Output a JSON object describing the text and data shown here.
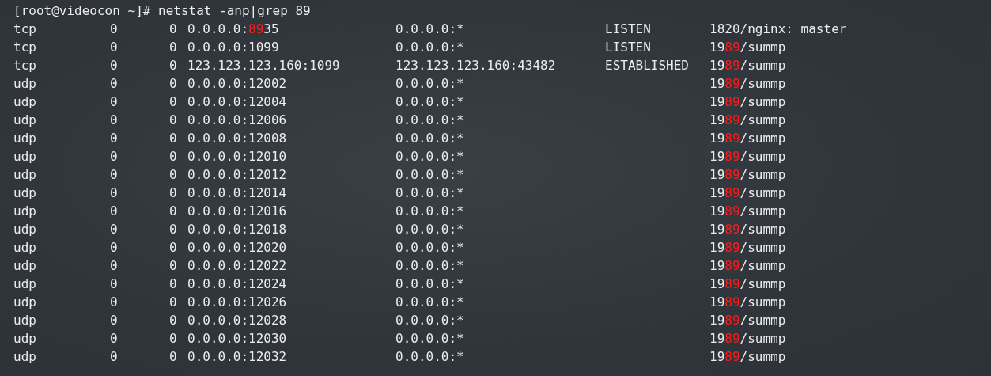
{
  "terminal": {
    "prompt": "[root@videocon ~]# netstat -anp|grep 89",
    "rows": [
      {
        "proto": "tcp",
        "recv_q": "0",
        "send_q": "0",
        "local": [
          {
            "text": "0.0.0.0:",
            "match": false
          },
          {
            "text": "89",
            "match": true
          },
          {
            "text": "35",
            "match": false
          }
        ],
        "foreign": "0.0.0.0:*",
        "state": "LISTEN",
        "program": [
          {
            "text": "1820/nginx: master",
            "match": false
          }
        ]
      },
      {
        "proto": "tcp",
        "recv_q": "0",
        "send_q": "0",
        "local": [
          {
            "text": "0.0.0.0:1099",
            "match": false
          }
        ],
        "foreign": "0.0.0.0:*",
        "state": "LISTEN",
        "program": [
          {
            "text": "19",
            "match": false
          },
          {
            "text": "89",
            "match": true
          },
          {
            "text": "/summp",
            "match": false
          }
        ]
      },
      {
        "proto": "tcp",
        "recv_q": "0",
        "send_q": "0",
        "local": [
          {
            "text": "123.123.123.160:1099",
            "match": false
          }
        ],
        "foreign": "123.123.123.160:43482",
        "state": "ESTABLISHED",
        "program": [
          {
            "text": "19",
            "match": false
          },
          {
            "text": "89",
            "match": true
          },
          {
            "text": "/summp",
            "match": false
          }
        ]
      },
      {
        "proto": "udp",
        "recv_q": "0",
        "send_q": "0",
        "local": [
          {
            "text": "0.0.0.0:12002",
            "match": false
          }
        ],
        "foreign": "0.0.0.0:*",
        "program": [
          {
            "text": "19",
            "match": false
          },
          {
            "text": "89",
            "match": true
          },
          {
            "text": "/summp",
            "match": false
          }
        ]
      },
      {
        "proto": "udp",
        "recv_q": "0",
        "send_q": "0",
        "local": [
          {
            "text": "0.0.0.0:12004",
            "match": false
          }
        ],
        "foreign": "0.0.0.0:*",
        "program": [
          {
            "text": "19",
            "match": false
          },
          {
            "text": "89",
            "match": true
          },
          {
            "text": "/summp",
            "match": false
          }
        ]
      },
      {
        "proto": "udp",
        "recv_q": "0",
        "send_q": "0",
        "local": [
          {
            "text": "0.0.0.0:12006",
            "match": false
          }
        ],
        "foreign": "0.0.0.0:*",
        "program": [
          {
            "text": "19",
            "match": false
          },
          {
            "text": "89",
            "match": true
          },
          {
            "text": "/summp",
            "match": false
          }
        ]
      },
      {
        "proto": "udp",
        "recv_q": "0",
        "send_q": "0",
        "local": [
          {
            "text": "0.0.0.0:12008",
            "match": false
          }
        ],
        "foreign": "0.0.0.0:*",
        "program": [
          {
            "text": "19",
            "match": false
          },
          {
            "text": "89",
            "match": true
          },
          {
            "text": "/summp",
            "match": false
          }
        ]
      },
      {
        "proto": "udp",
        "recv_q": "0",
        "send_q": "0",
        "local": [
          {
            "text": "0.0.0.0:12010",
            "match": false
          }
        ],
        "foreign": "0.0.0.0:*",
        "program": [
          {
            "text": "19",
            "match": false
          },
          {
            "text": "89",
            "match": true
          },
          {
            "text": "/summp",
            "match": false
          }
        ]
      },
      {
        "proto": "udp",
        "recv_q": "0",
        "send_q": "0",
        "local": [
          {
            "text": "0.0.0.0:12012",
            "match": false
          }
        ],
        "foreign": "0.0.0.0:*",
        "program": [
          {
            "text": "19",
            "match": false
          },
          {
            "text": "89",
            "match": true
          },
          {
            "text": "/summp",
            "match": false
          }
        ]
      },
      {
        "proto": "udp",
        "recv_q": "0",
        "send_q": "0",
        "local": [
          {
            "text": "0.0.0.0:12014",
            "match": false
          }
        ],
        "foreign": "0.0.0.0:*",
        "program": [
          {
            "text": "19",
            "match": false
          },
          {
            "text": "89",
            "match": true
          },
          {
            "text": "/summp",
            "match": false
          }
        ]
      },
      {
        "proto": "udp",
        "recv_q": "0",
        "send_q": "0",
        "local": [
          {
            "text": "0.0.0.0:12016",
            "match": false
          }
        ],
        "foreign": "0.0.0.0:*",
        "program": [
          {
            "text": "19",
            "match": false
          },
          {
            "text": "89",
            "match": true
          },
          {
            "text": "/summp",
            "match": false
          }
        ]
      },
      {
        "proto": "udp",
        "recv_q": "0",
        "send_q": "0",
        "local": [
          {
            "text": "0.0.0.0:12018",
            "match": false
          }
        ],
        "foreign": "0.0.0.0:*",
        "program": [
          {
            "text": "19",
            "match": false
          },
          {
            "text": "89",
            "match": true
          },
          {
            "text": "/summp",
            "match": false
          }
        ]
      },
      {
        "proto": "udp",
        "recv_q": "0",
        "send_q": "0",
        "local": [
          {
            "text": "0.0.0.0:12020",
            "match": false
          }
        ],
        "foreign": "0.0.0.0:*",
        "program": [
          {
            "text": "19",
            "match": false
          },
          {
            "text": "89",
            "match": true
          },
          {
            "text": "/summp",
            "match": false
          }
        ]
      },
      {
        "proto": "udp",
        "recv_q": "0",
        "send_q": "0",
        "local": [
          {
            "text": "0.0.0.0:12022",
            "match": false
          }
        ],
        "foreign": "0.0.0.0:*",
        "program": [
          {
            "text": "19",
            "match": false
          },
          {
            "text": "89",
            "match": true
          },
          {
            "text": "/summp",
            "match": false
          }
        ]
      },
      {
        "proto": "udp",
        "recv_q": "0",
        "send_q": "0",
        "local": [
          {
            "text": "0.0.0.0:12024",
            "match": false
          }
        ],
        "foreign": "0.0.0.0:*",
        "program": [
          {
            "text": "19",
            "match": false
          },
          {
            "text": "89",
            "match": true
          },
          {
            "text": "/summp",
            "match": false
          }
        ]
      },
      {
        "proto": "udp",
        "recv_q": "0",
        "send_q": "0",
        "local": [
          {
            "text": "0.0.0.0:12026",
            "match": false
          }
        ],
        "foreign": "0.0.0.0:*",
        "program": [
          {
            "text": "19",
            "match": false
          },
          {
            "text": "89",
            "match": true
          },
          {
            "text": "/summp",
            "match": false
          }
        ]
      },
      {
        "proto": "udp",
        "recv_q": "0",
        "send_q": "0",
        "local": [
          {
            "text": "0.0.0.0:12028",
            "match": false
          }
        ],
        "foreign": "0.0.0.0:*",
        "program": [
          {
            "text": "19",
            "match": false
          },
          {
            "text": "89",
            "match": true
          },
          {
            "text": "/summp",
            "match": false
          }
        ]
      },
      {
        "proto": "udp",
        "recv_q": "0",
        "send_q": "0",
        "local": [
          {
            "text": "0.0.0.0:12030",
            "match": false
          }
        ],
        "foreign": "0.0.0.0:*",
        "program": [
          {
            "text": "19",
            "match": false
          },
          {
            "text": "89",
            "match": true
          },
          {
            "text": "/summp",
            "match": false
          }
        ]
      },
      {
        "proto": "udp",
        "recv_q": "0",
        "send_q": "0",
        "local": [
          {
            "text": "0.0.0.0:12032",
            "match": false
          }
        ],
        "foreign": "0.0.0.0:*",
        "program": [
          {
            "text": "19",
            "match": false
          },
          {
            "text": "89",
            "match": true
          },
          {
            "text": "/summp",
            "match": false
          }
        ]
      }
    ]
  }
}
